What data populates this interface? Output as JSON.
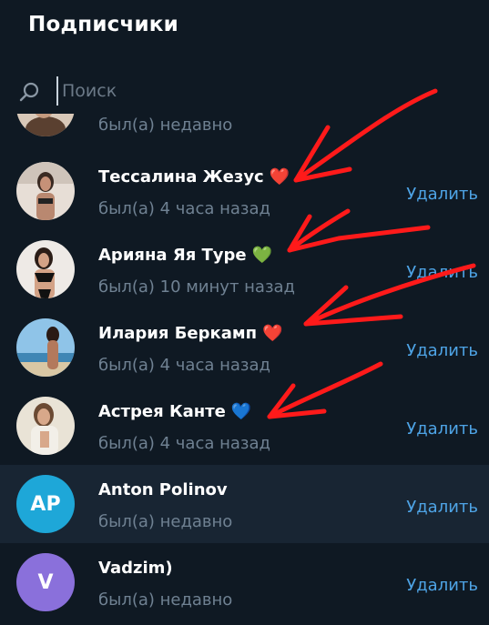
{
  "header": {
    "title": "Подписчики"
  },
  "search": {
    "placeholder": "Поиск",
    "value": ""
  },
  "colors": {
    "background": "#0f1923",
    "highlight_row": "#182533",
    "accent_link": "#4ea4e6",
    "status_text": "#6f8192",
    "annotation_arrow": "#ff1a1a"
  },
  "subscribers": [
    {
      "name": "",
      "emoji": "",
      "status": "был(а) недавно",
      "remove_label": "",
      "avatar": "photo"
    },
    {
      "name": "Тессалина Жезус",
      "emoji": "❤️",
      "status": "был(а) 4 часа назад",
      "remove_label": "Удалить",
      "avatar": "photo"
    },
    {
      "name": " Арияна Яя Туре",
      "emoji": "💚",
      "status": "был(а) 10 минут назад",
      "remove_label": "Удалить",
      "avatar": "photo"
    },
    {
      "name": "Илария Беркамп",
      "emoji": "❤️",
      "status": "был(а) 4 часа назад",
      "remove_label": "Удалить",
      "avatar": "photo"
    },
    {
      "name": "Астрея Канте",
      "emoji": "💙",
      "status": "был(а) 4 часа назад",
      "remove_label": "Удалить",
      "avatar": "photo"
    },
    {
      "name": "Anton Polinov",
      "emoji": "",
      "status": "был(а) недавно",
      "remove_label": "Удалить",
      "avatar": "initials",
      "initials": "AP",
      "avatar_color": "#1ea7d8"
    },
    {
      "name": "Vadzim)",
      "emoji": "",
      "status": "был(а) недавно",
      "remove_label": "Удалить",
      "avatar": "initials",
      "initials": "V",
      "avatar_color": "#8a70db"
    }
  ]
}
